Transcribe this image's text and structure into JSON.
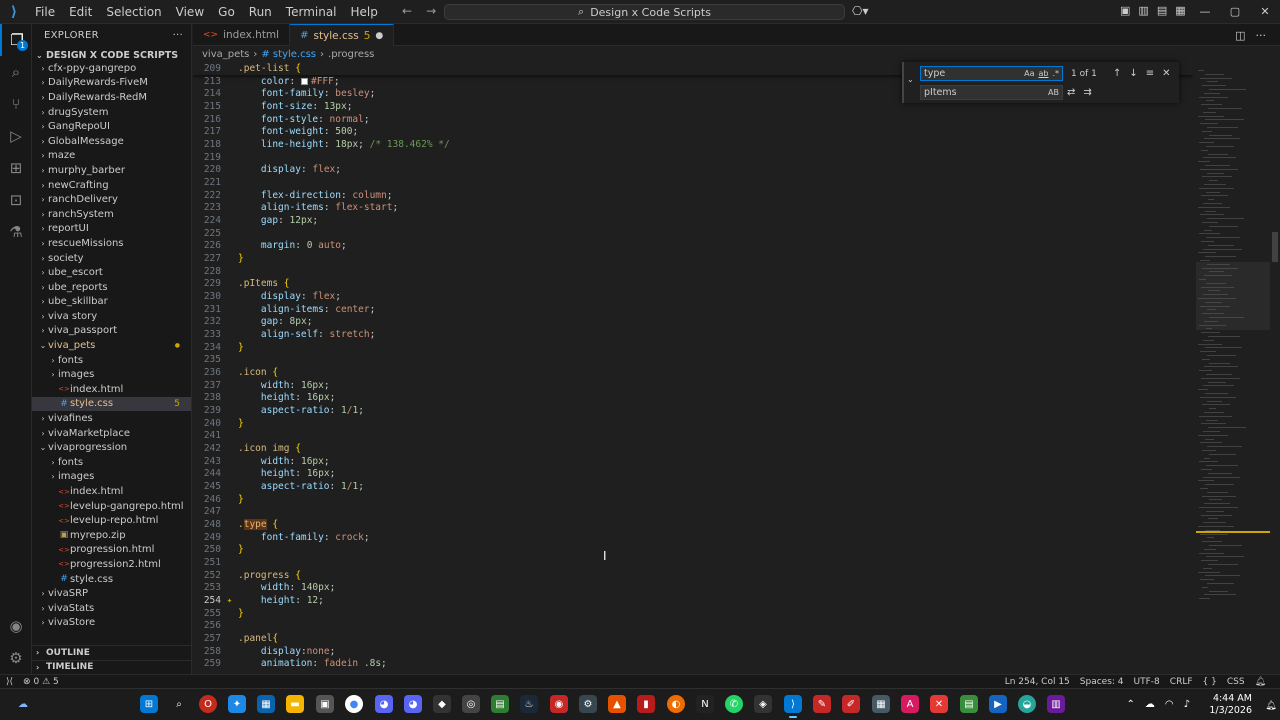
{
  "menu": [
    "File",
    "Edit",
    "Selection",
    "View",
    "Go",
    "Run",
    "Terminal",
    "Help"
  ],
  "command_center": "Design x Code Scripts",
  "explorer": {
    "title": "EXPLORER",
    "root": "DESIGN X CODE SCRIPTS",
    "items": [
      {
        "label": "cfx-ppy-gangrepo",
        "level": 1,
        "type": "folder",
        "open": false
      },
      {
        "label": "DailyRewards-FiveM",
        "level": 1,
        "type": "folder",
        "open": false
      },
      {
        "label": "DailyRewards-RedM",
        "level": 1,
        "type": "folder",
        "open": false
      },
      {
        "label": "drugSystem",
        "level": 1,
        "type": "folder",
        "open": false
      },
      {
        "label": "GangRepoUI",
        "level": 1,
        "type": "folder",
        "open": false
      },
      {
        "label": "GlobalMessage",
        "level": 1,
        "type": "folder",
        "open": false
      },
      {
        "label": "maze",
        "level": 1,
        "type": "folder",
        "open": false
      },
      {
        "label": "murphy_barber",
        "level": 1,
        "type": "folder",
        "open": false
      },
      {
        "label": "newCrafting",
        "level": 1,
        "type": "folder",
        "open": false
      },
      {
        "label": "ranchDelivery",
        "level": 1,
        "type": "folder",
        "open": false
      },
      {
        "label": "ranchSystem",
        "level": 1,
        "type": "folder",
        "open": false
      },
      {
        "label": "reportUI",
        "level": 1,
        "type": "folder",
        "open": false
      },
      {
        "label": "rescueMissions",
        "level": 1,
        "type": "folder",
        "open": false
      },
      {
        "label": "society",
        "level": 1,
        "type": "folder",
        "open": false
      },
      {
        "label": "ube_escort",
        "level": 1,
        "type": "folder",
        "open": false
      },
      {
        "label": "ube_reports",
        "level": 1,
        "type": "folder",
        "open": false
      },
      {
        "label": "ube_skillbar",
        "level": 1,
        "type": "folder",
        "open": false
      },
      {
        "label": "viva story",
        "level": 1,
        "type": "folder",
        "open": false
      },
      {
        "label": "viva_passport",
        "level": 1,
        "type": "folder",
        "open": false
      },
      {
        "label": "viva_pets",
        "level": 1,
        "type": "folder",
        "open": true,
        "modified": true
      },
      {
        "label": "fonts",
        "level": 2,
        "type": "folder",
        "open": false
      },
      {
        "label": "images",
        "level": 2,
        "type": "folder",
        "open": false
      },
      {
        "label": "index.html",
        "level": 2,
        "type": "html"
      },
      {
        "label": "style.css",
        "level": 2,
        "type": "css",
        "selected": true,
        "count": "5"
      },
      {
        "label": "vivafines",
        "level": 1,
        "type": "folder",
        "open": false
      },
      {
        "label": "vivaMarketplace",
        "level": 1,
        "type": "folder",
        "open": false
      },
      {
        "label": "vivaprogression",
        "level": 1,
        "type": "folder",
        "open": true
      },
      {
        "label": "fonts",
        "level": 2,
        "type": "folder",
        "open": false
      },
      {
        "label": "images",
        "level": 2,
        "type": "folder",
        "open": false
      },
      {
        "label": "index.html",
        "level": 2,
        "type": "html"
      },
      {
        "label": "levelup-gangrepo.html",
        "level": 2,
        "type": "html"
      },
      {
        "label": "levelup-repo.html",
        "level": 2,
        "type": "html"
      },
      {
        "label": "myrepo.zip",
        "level": 2,
        "type": "zip"
      },
      {
        "label": "progression.html",
        "level": 2,
        "type": "html"
      },
      {
        "label": "progression2.html",
        "level": 2,
        "type": "html"
      },
      {
        "label": "style.css",
        "level": 2,
        "type": "css"
      },
      {
        "label": "vivaSRP",
        "level": 1,
        "type": "folder",
        "open": false
      },
      {
        "label": "vivaStats",
        "level": 1,
        "type": "folder",
        "open": false
      },
      {
        "label": "vivaStore",
        "level": 1,
        "type": "folder",
        "open": false
      }
    ],
    "outline": "OUTLINE",
    "timeline": "TIMELINE"
  },
  "tabs": [
    {
      "label": "index.html",
      "active": false
    },
    {
      "label": "style.css",
      "count": "5",
      "active": true
    }
  ],
  "breadcrumb": [
    "viva_pets",
    "# style.css",
    ".progress"
  ],
  "sticky_line": {
    "num": "209",
    "text": ".pet-list {"
  },
  "code_lines": [
    {
      "num": "213",
      "t": "    color: #FFF;",
      "k": "color"
    },
    {
      "num": "214",
      "t": "    font-family: besley;"
    },
    {
      "num": "215",
      "t": "    font-size: 13px;"
    },
    {
      "num": "216",
      "t": "    font-style: normal;"
    },
    {
      "num": "217",
      "t": "    font-weight: 500;"
    },
    {
      "num": "218",
      "t": "    line-height: 18px; /* 138.462% */"
    },
    {
      "num": "219",
      "t": ""
    },
    {
      "num": "220",
      "t": "    display: flex;"
    },
    {
      "num": "221",
      "t": ""
    },
    {
      "num": "222",
      "t": "    flex-direction: column;"
    },
    {
      "num": "223",
      "t": "    align-items: flex-start;"
    },
    {
      "num": "224",
      "t": "    gap: 12px;"
    },
    {
      "num": "225",
      "t": ""
    },
    {
      "num": "226",
      "t": "    margin: 0 auto;"
    },
    {
      "num": "227",
      "t": "}"
    },
    {
      "num": "228",
      "t": ""
    },
    {
      "num": "229",
      "t": ".pItems {"
    },
    {
      "num": "230",
      "t": "    display: flex;"
    },
    {
      "num": "231",
      "t": "    align-items: center;"
    },
    {
      "num": "232",
      "t": "    gap: 8px;"
    },
    {
      "num": "233",
      "t": "    align-self: stretch;"
    },
    {
      "num": "234",
      "t": "}"
    },
    {
      "num": "235",
      "t": ""
    },
    {
      "num": "236",
      "t": ".icon {"
    },
    {
      "num": "237",
      "t": "    width: 16px;"
    },
    {
      "num": "238",
      "t": "    height: 16px;"
    },
    {
      "num": "239",
      "t": "    aspect-ratio: 1/1;"
    },
    {
      "num": "240",
      "t": "}"
    },
    {
      "num": "241",
      "t": ""
    },
    {
      "num": "242",
      "t": ".icon img {"
    },
    {
      "num": "243",
      "t": "    width: 16px;"
    },
    {
      "num": "244",
      "t": "    height: 16px;"
    },
    {
      "num": "245",
      "t": "    aspect-ratio: 1/1;"
    },
    {
      "num": "246",
      "t": "}"
    },
    {
      "num": "247",
      "t": ""
    },
    {
      "num": "248",
      "t": ".type {",
      "k": "findhl"
    },
    {
      "num": "249",
      "t": "    font-family: crock;"
    },
    {
      "num": "250",
      "t": "}"
    },
    {
      "num": "251",
      "t": ""
    },
    {
      "num": "252",
      "t": ".progress {"
    },
    {
      "num": "253",
      "t": "    width: 140px;"
    },
    {
      "num": "254",
      "t": "    height: 12;",
      "k": "current"
    },
    {
      "num": "255",
      "t": "}"
    },
    {
      "num": "256",
      "t": ""
    },
    {
      "num": "257",
      "t": ".panel{"
    },
    {
      "num": "258",
      "t": "    display:none;"
    },
    {
      "num": "259",
      "t": "    animation: fadein .8s;"
    }
  ],
  "find": {
    "find_value": "type",
    "replace_value": "pItems",
    "result": "1 of 1",
    "opt_case": "Aa",
    "opt_word": "ab",
    "opt_regex": ".*",
    "opt_preserve": "AB"
  },
  "status": {
    "errors": "0",
    "warnings": "5",
    "position": "Ln 254, Col 15",
    "spaces": "Spaces: 4",
    "encoding": "UTF-8",
    "eol": "CRLF",
    "braces": "{ }",
    "language": "CSS"
  },
  "clock": {
    "time": "4:44 AM",
    "date": "1/3/2026"
  },
  "colors": {
    "accent": "#0078d4",
    "warning": "#cca700",
    "modified": "#e2c08d"
  }
}
